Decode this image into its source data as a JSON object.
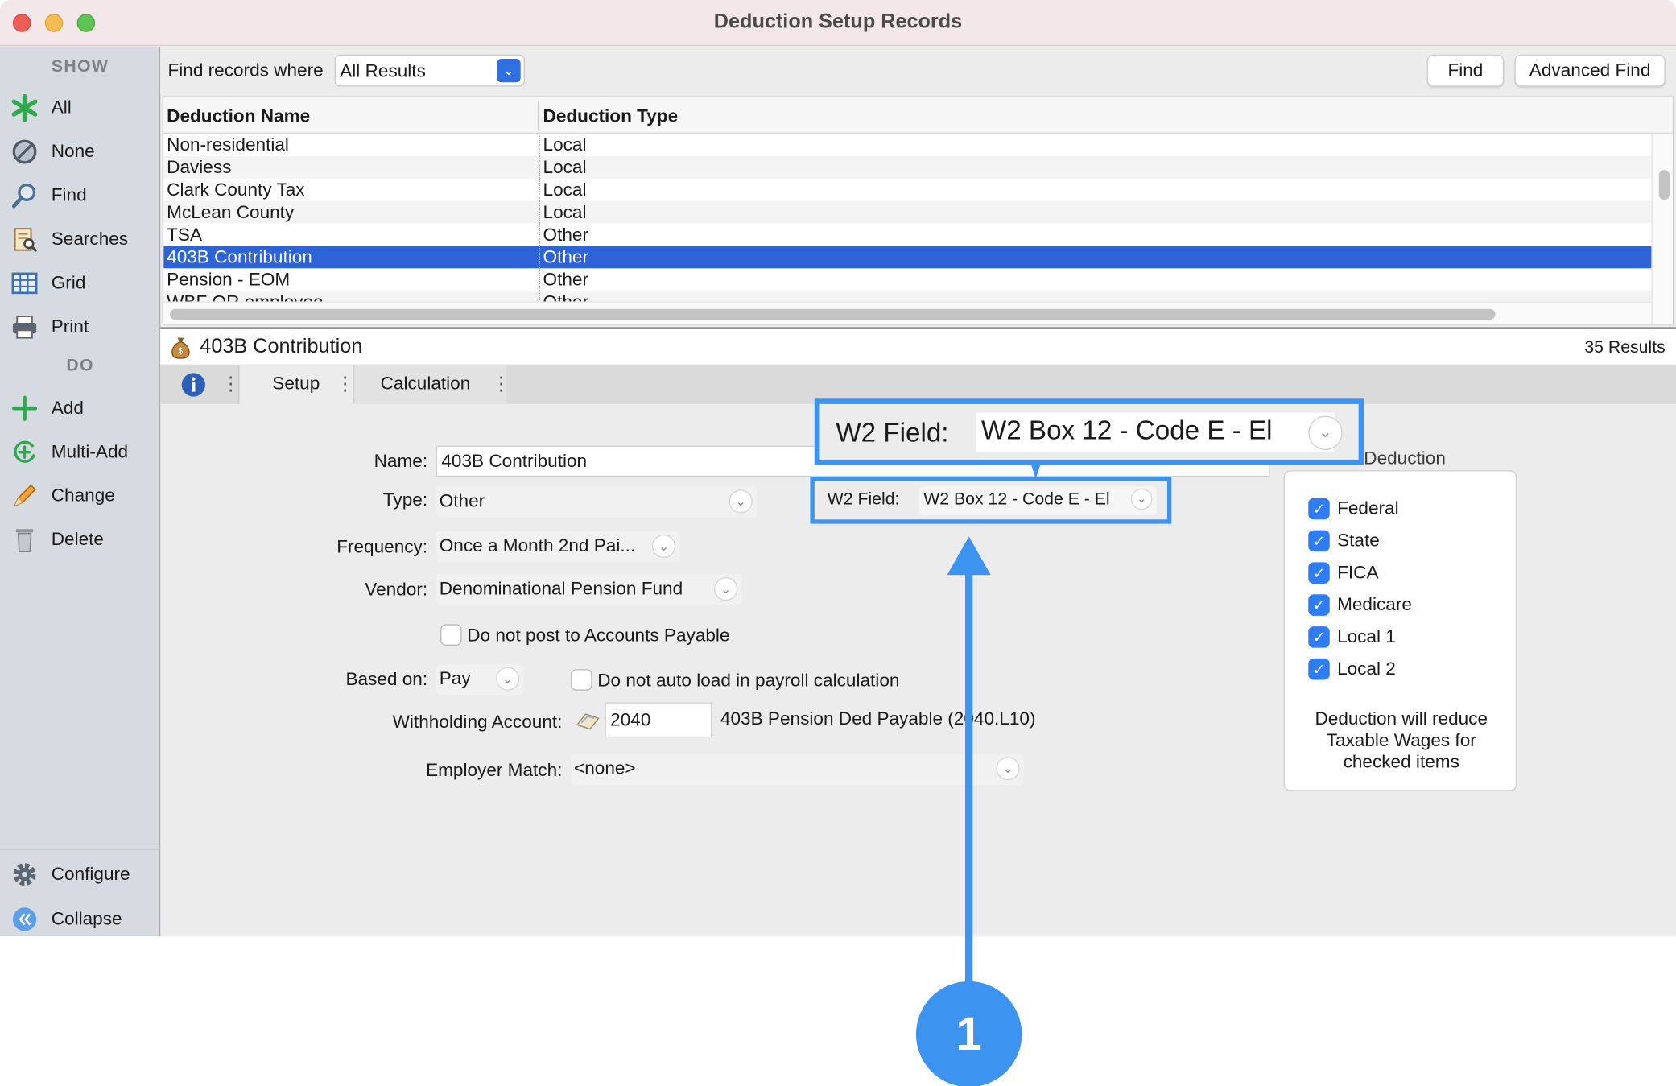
{
  "window": {
    "title": "Deduction Setup Records"
  },
  "sidebar": {
    "show_heading": "SHOW",
    "do_heading": "DO",
    "show_items": [
      {
        "label": "All",
        "icon": "asterisk-icon"
      },
      {
        "label": "None",
        "icon": "none-icon"
      },
      {
        "label": "Find",
        "icon": "magnifier-icon"
      },
      {
        "label": "Searches",
        "icon": "searches-icon"
      },
      {
        "label": "Grid",
        "icon": "grid-icon"
      },
      {
        "label": "Print",
        "icon": "printer-icon"
      }
    ],
    "do_items": [
      {
        "label": "Add",
        "icon": "plus-icon"
      },
      {
        "label": "Multi-Add",
        "icon": "multi-add-icon"
      },
      {
        "label": "Change",
        "icon": "pencil-icon"
      },
      {
        "label": "Delete",
        "icon": "trash-icon"
      }
    ],
    "bottom_items": [
      {
        "label": "Configure",
        "icon": "gear-icon"
      },
      {
        "label": "Collapse",
        "icon": "collapse-icon"
      }
    ]
  },
  "findbar": {
    "label": "Find records where",
    "selected": "All Results",
    "find_button": "Find",
    "advanced_button": "Advanced Find"
  },
  "table": {
    "columns": [
      "Deduction Name",
      "Deduction Type"
    ],
    "rows": [
      [
        "Non-residential",
        "Local"
      ],
      [
        "Daviess",
        "Local"
      ],
      [
        "Clark County Tax",
        "Local"
      ],
      [
        "McLean County",
        "Local"
      ],
      [
        "TSA",
        "Other"
      ],
      [
        "403B Contribution",
        "Other"
      ],
      [
        "Pension - EOM",
        "Other"
      ],
      [
        "WBF OR employee",
        "Other"
      ]
    ],
    "selected_index": 5
  },
  "record": {
    "title": "403B Contribution",
    "results": "35 Results",
    "tabs": [
      "Setup",
      "Calculation"
    ]
  },
  "form": {
    "name_label": "Name:",
    "name_value": "403B Contribution",
    "type_label": "Type:",
    "type_value": "Other",
    "w2_label": "W2 Field:",
    "w2_value": "W2 Box 12 - Code E - El",
    "frequency_label": "Frequency:",
    "frequency_value": "Once a Month 2nd Pai...",
    "vendor_label": "Vendor:",
    "vendor_value": "Denominational Pension Fund",
    "no_post_label": "Do not post to Accounts Payable",
    "based_on_label": "Based on:",
    "based_on_value": "Pay",
    "no_autoload_label": "Do not auto load in payroll calculation",
    "withholding_label": "Withholding Account:",
    "withholding_value": "2040",
    "withholding_desc": "403B Pension Ded Payable (2040.L10)",
    "employer_match_label": "Employer Match:",
    "employer_match_value": "<none>"
  },
  "taxes": {
    "legend": "Deduction",
    "items": [
      "Federal",
      "State",
      "FICA",
      "Medicare",
      "Local 1",
      "Local 2"
    ],
    "note": "Deduction will reduce Taxable Wages for checked items"
  },
  "annotation": {
    "badge": "1",
    "color": "#3d93f0"
  }
}
